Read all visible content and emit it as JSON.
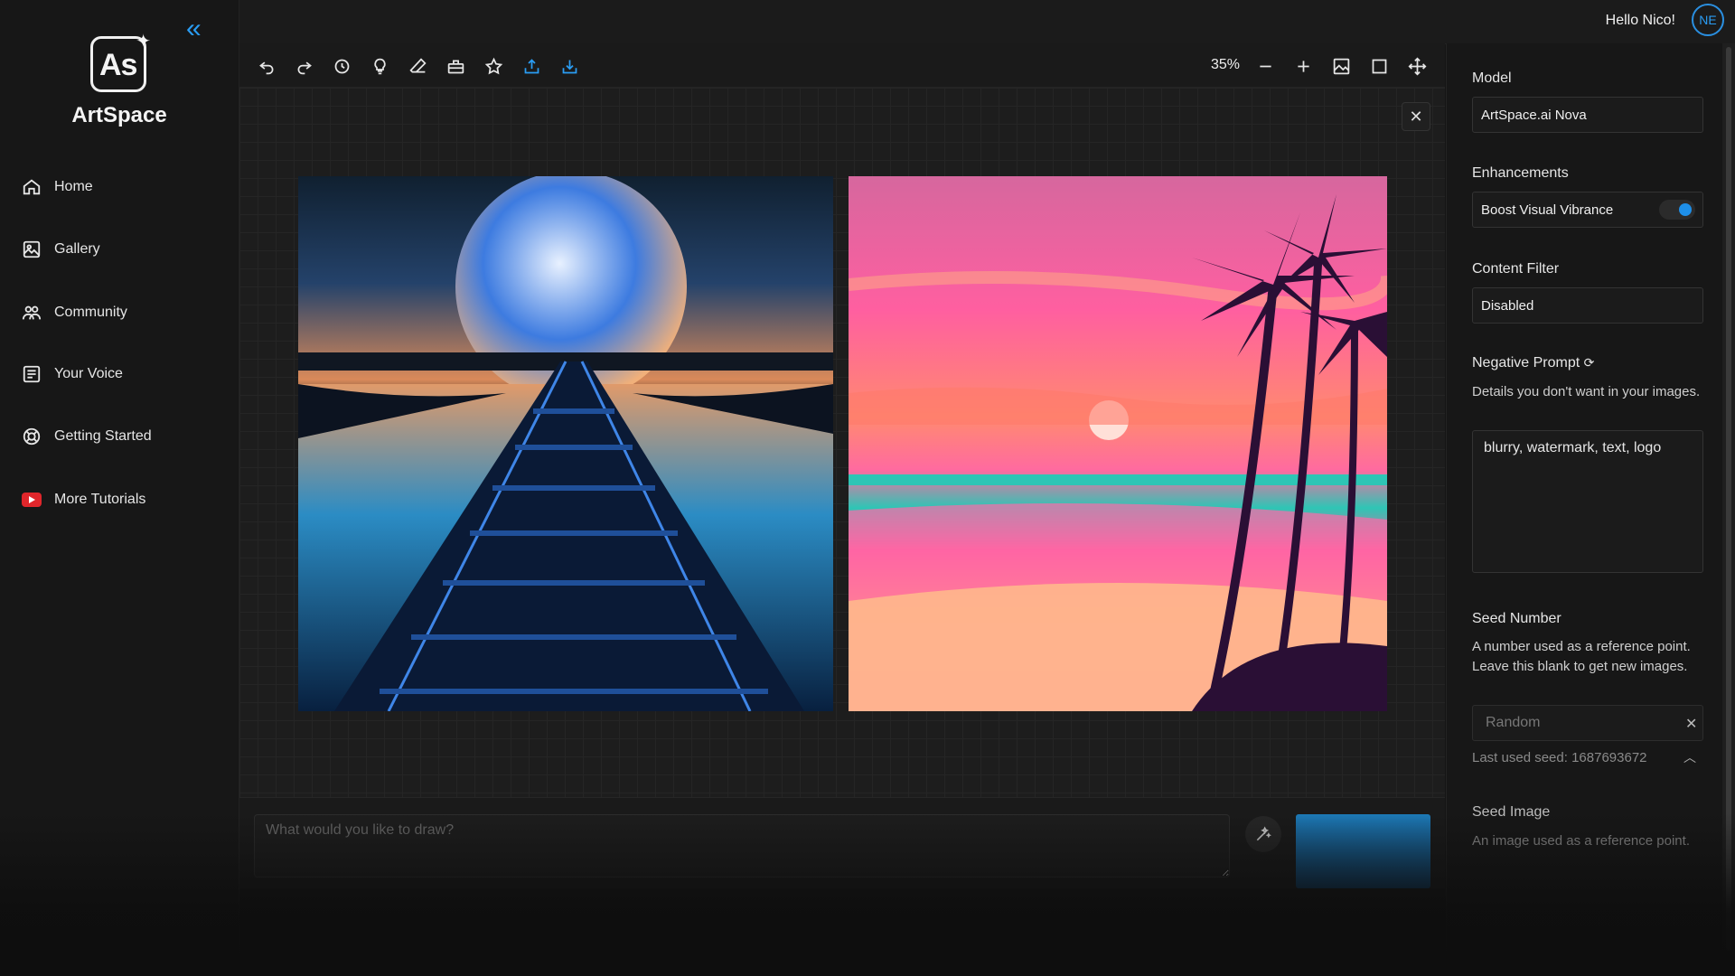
{
  "app": {
    "name": "ArtSpace",
    "logo_text": "As"
  },
  "header": {
    "greeting": "Hello Nico!",
    "avatar_initials": "NE"
  },
  "sidebar": {
    "items": [
      {
        "label": "Home",
        "icon": "home-icon"
      },
      {
        "label": "Gallery",
        "icon": "gallery-icon"
      },
      {
        "label": "Community",
        "icon": "community-icon"
      },
      {
        "label": "Your Voice",
        "icon": "feedback-icon"
      },
      {
        "label": "Getting Started",
        "icon": "lifebuoy-icon"
      },
      {
        "label": "More Tutorials",
        "icon": "youtube-icon"
      }
    ]
  },
  "toolbar": {
    "zoom": "35%",
    "icons": [
      "undo-icon",
      "redo-icon",
      "history-icon",
      "lightbulb-icon",
      "eraser-icon",
      "toolbox-icon",
      "star-icon",
      "upload-icon",
      "download-icon",
      "zoom-out-icon",
      "zoom-in-icon",
      "image-icon",
      "square-icon",
      "move-icon"
    ]
  },
  "prompt": {
    "placeholder": "What would you like to draw?"
  },
  "panel": {
    "model_label": "Model",
    "model_value": "ArtSpace.ai Nova",
    "enhancements_label": "Enhancements",
    "enhancement_option": "Boost Visual Vibrance",
    "enhancement_enabled": true,
    "content_filter_label": "Content Filter",
    "content_filter_value": "Disabled",
    "negative_prompt_label": "Negative Prompt",
    "negative_prompt_desc": "Details you don't want in your images.",
    "negative_prompt_value": "blurry, watermark, text, logo",
    "seed_number_label": "Seed Number",
    "seed_number_desc": "A number used as a reference point. Leave this blank to get new images.",
    "seed_placeholder": "Random",
    "last_used_seed": "Last used seed: 1687693672",
    "seed_image_label": "Seed Image",
    "seed_image_desc": "An image used as a reference point."
  },
  "colors": {
    "accent": "#2a9df4",
    "background": "#151515",
    "youtube": "#e0262b"
  }
}
